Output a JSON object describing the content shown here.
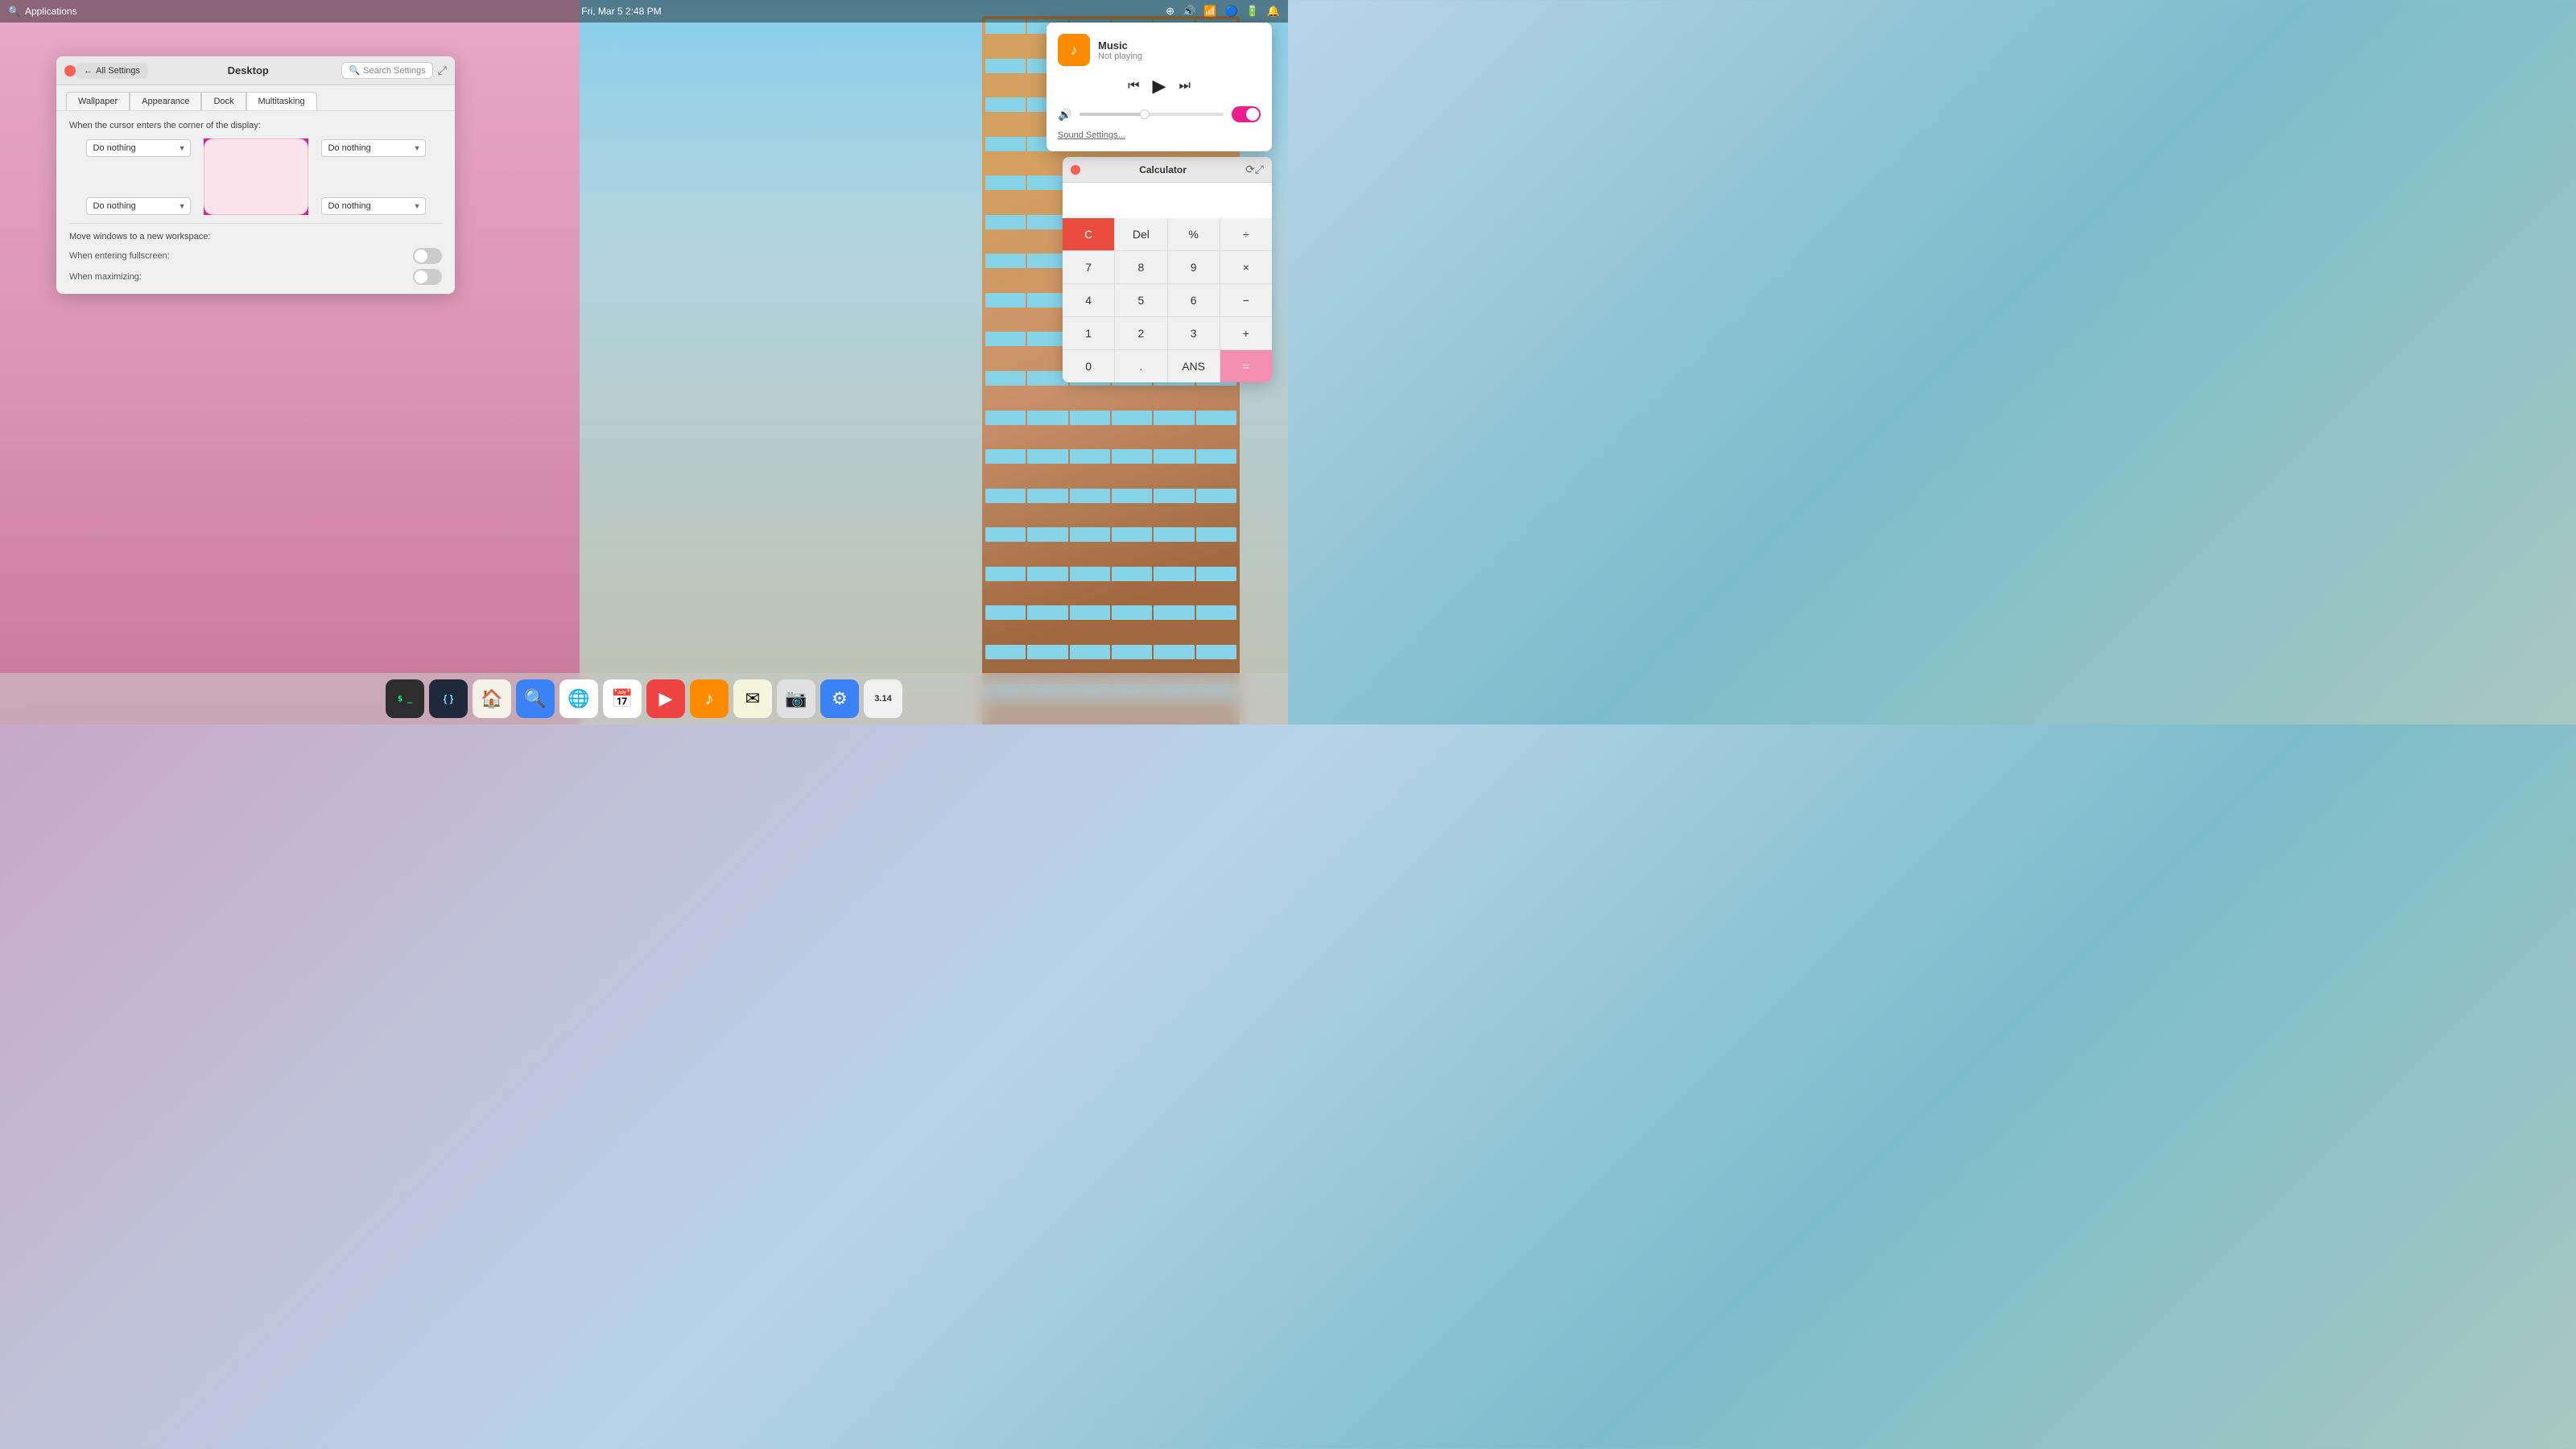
{
  "taskbar": {
    "app_label": "Applications",
    "datetime": "Fri, Mar 5  2:48 PM",
    "icons": [
      "accessibility",
      "volume",
      "wifi",
      "bluetooth",
      "battery",
      "notification"
    ]
  },
  "music_popup": {
    "title": "Music",
    "status": "Not playing",
    "play_btn": "▶",
    "prev_btn": "⏮",
    "next_btn": "⏭",
    "sound_settings": "Sound Settings..."
  },
  "settings_window": {
    "title": "Desktop",
    "back_label": "All Settings",
    "search_placeholder": "Search Settings",
    "tabs": [
      "Wallpaper",
      "Appearance",
      "Dock",
      "Multitasking"
    ],
    "active_tab": "Multitasking",
    "corner_label": "When the cursor enters the corner of the display:",
    "top_left_select": "Do nothing",
    "top_right_select": "Do nothing",
    "bottom_left_select": "Do nothing",
    "bottom_right_select": "Do nothing",
    "move_windows_label": "Move windows to a new workspace:",
    "fullscreen_label": "When entering fullscreen:",
    "maximizing_label": "When maximizing:"
  },
  "calculator": {
    "title": "Calculator",
    "display": "",
    "buttons": [
      [
        "C",
        "Del",
        "%",
        "÷"
      ],
      [
        "7",
        "8",
        "9",
        "×"
      ],
      [
        "4",
        "5",
        "6",
        "−"
      ],
      [
        "1",
        "2",
        "3",
        "+"
      ],
      [
        "0",
        ".",
        "ANS",
        "="
      ]
    ]
  },
  "dock": {
    "items": [
      {
        "name": "terminal",
        "label": "$ _"
      },
      {
        "name": "css-editor",
        "label": "{ }"
      },
      {
        "name": "files",
        "label": "🏠"
      },
      {
        "name": "search",
        "label": "🔍"
      },
      {
        "name": "browser",
        "label": "🌐"
      },
      {
        "name": "calendar",
        "label": "📅"
      },
      {
        "name": "video",
        "label": "▶"
      },
      {
        "name": "music",
        "label": "♪"
      },
      {
        "name": "mail",
        "label": "✉"
      },
      {
        "name": "photos",
        "label": "📷"
      },
      {
        "name": "settings",
        "label": "⚙"
      },
      {
        "name": "calculator",
        "label": "="
      }
    ]
  }
}
